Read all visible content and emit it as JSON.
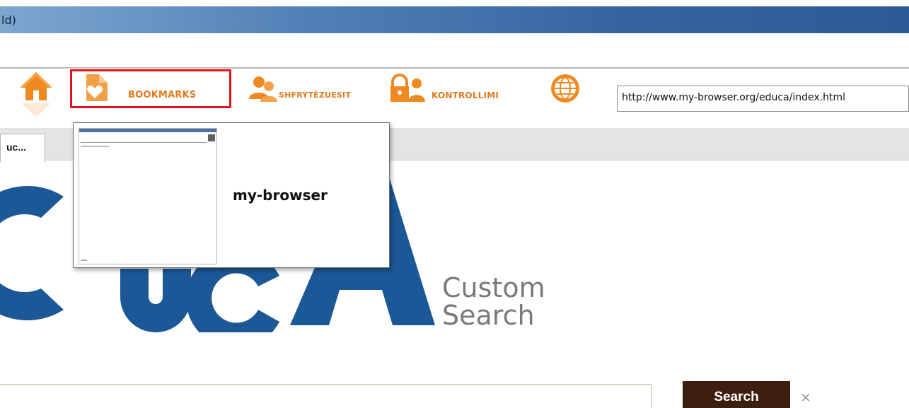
{
  "window": {
    "title_fragment": "ld)"
  },
  "toolbar": {
    "home_icon": "home-icon",
    "bookmarks_label": "BOOKMARKS",
    "shares_label": "SHFRYTËZUESIT",
    "parental_label": "KONTROLLIMI",
    "globe_icon": "globe-icon",
    "url": "http://www.my-browser.org/educa/index.html",
    "accent_color": "#e37a1f",
    "highlight_color": "#e0161c"
  },
  "tabs": [
    {
      "label": "uc..."
    }
  ],
  "bookmarks_popup": {
    "title": "my-browser"
  },
  "page": {
    "logo_tagline_line1": "Custom",
    "logo_tagline_line2": "Search",
    "logo_color": "#1c5797",
    "search_button_label": "Search",
    "clear_label": "×"
  }
}
